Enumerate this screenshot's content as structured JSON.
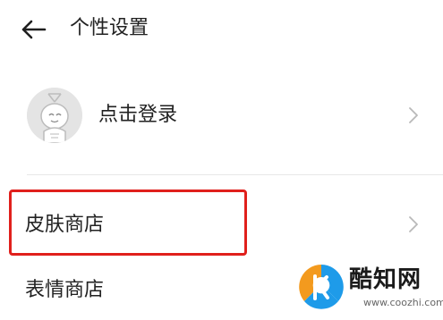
{
  "header": {
    "title": "个性设置",
    "back_icon": "arrow-left-icon"
  },
  "login": {
    "label": "点击登录",
    "avatar_icon": "default-avatar-icon",
    "chevron_icon": "chevron-right-icon"
  },
  "menu": {
    "skin_store": {
      "label": "皮肤商店",
      "chevron_icon": "chevron-right-icon",
      "highlighted": true
    },
    "emoji_store": {
      "label": "表情商店"
    }
  },
  "watermark": {
    "name": "酷知网",
    "url": "www.coozhi.com"
  },
  "colors": {
    "highlight_border": "#e0201c",
    "divider": "#e8e8e8",
    "logo_orange": "#f39a1e",
    "logo_blue": "#1e9be9"
  }
}
